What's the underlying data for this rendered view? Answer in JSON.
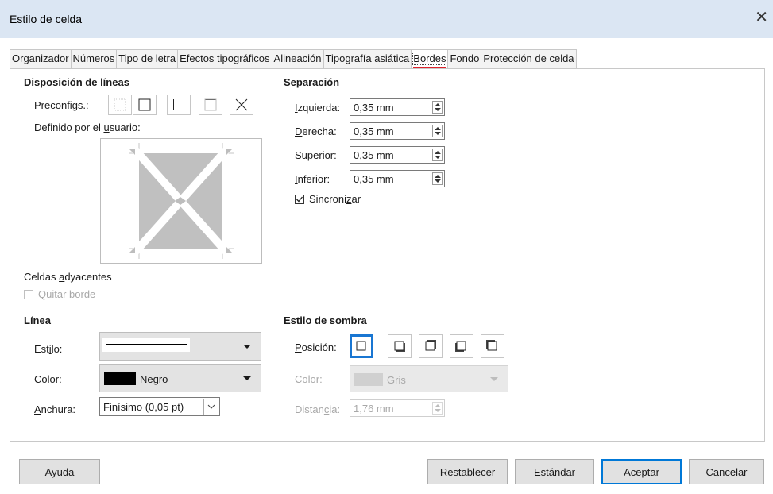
{
  "window": {
    "title": "Estilo de celda",
    "close_icon": "close-icon"
  },
  "tabs": [
    {
      "label": "Organizador"
    },
    {
      "label": "Números"
    },
    {
      "label": "Tipo de letra"
    },
    {
      "label": "Efectos tipográficos"
    },
    {
      "label": "Alineación"
    },
    {
      "label": "Tipografía asiática"
    },
    {
      "label": "Bordes",
      "active": true
    },
    {
      "label": "Fondo"
    },
    {
      "label": "Protección de celda"
    }
  ],
  "line_arrangement": {
    "heading": "Disposición de líneas",
    "presets_pre": "Pre",
    "presets_u": "c",
    "presets_post": "onfigs.:",
    "user_pre": "Definido por el ",
    "user_u": "u",
    "user_post": "suario:",
    "adjacent_pre": "Celdas ",
    "adjacent_u": "a",
    "adjacent_post": "dyacentes",
    "remove_u": "Q",
    "remove_post": "uitar borde",
    "remove_checked": false
  },
  "padding": {
    "heading": "Separación",
    "left": {
      "u": "I",
      "rest": "zquierda:",
      "value": "0,35 mm"
    },
    "right": {
      "u": "D",
      "rest": "erecha:",
      "value": "0,35 mm"
    },
    "top": {
      "u": "S",
      "rest": "uperior:",
      "value": "0,35 mm"
    },
    "bottom": {
      "u": "I",
      "rest": "nferior:",
      "value": "0,35 mm"
    },
    "sync_pre": "Sincroni",
    "sync_u": "z",
    "sync_post": "ar",
    "sync_checked": true
  },
  "line": {
    "heading": "Línea",
    "style_pre": "Est",
    "style_u": "i",
    "style_post": "lo:",
    "color_u": "C",
    "color_post": "olor:",
    "color_value": "Negro",
    "color_swatch": "#000000",
    "width_u": "A",
    "width_post": "nchura:",
    "width_value": "Finísimo (0,05 pt)"
  },
  "shadow": {
    "heading": "Estilo de sombra",
    "position_u": "P",
    "position_post": "osición:",
    "color_pre": "Co",
    "color_u": "l",
    "color_post": "or:",
    "color_value": "Gris",
    "color_swatch": "#d8d8d8",
    "distance_pre": "Distan",
    "distance_u": "c",
    "distance_post": "ia:",
    "distance_value": "1,76 mm"
  },
  "buttons": {
    "help_pre": "Ay",
    "help_u": "u",
    "help_post": "da",
    "reset_u": "R",
    "reset_post": "establecer",
    "standard_u": "E",
    "standard_post": "stándar",
    "ok_u": "A",
    "ok_post": "ceptar",
    "cancel_u": "C",
    "cancel_post": "ancelar"
  },
  "colors": {
    "accent": "#0078d7",
    "selected_shadow": "#1976d2",
    "active_tab_underline": "#e0232c"
  }
}
